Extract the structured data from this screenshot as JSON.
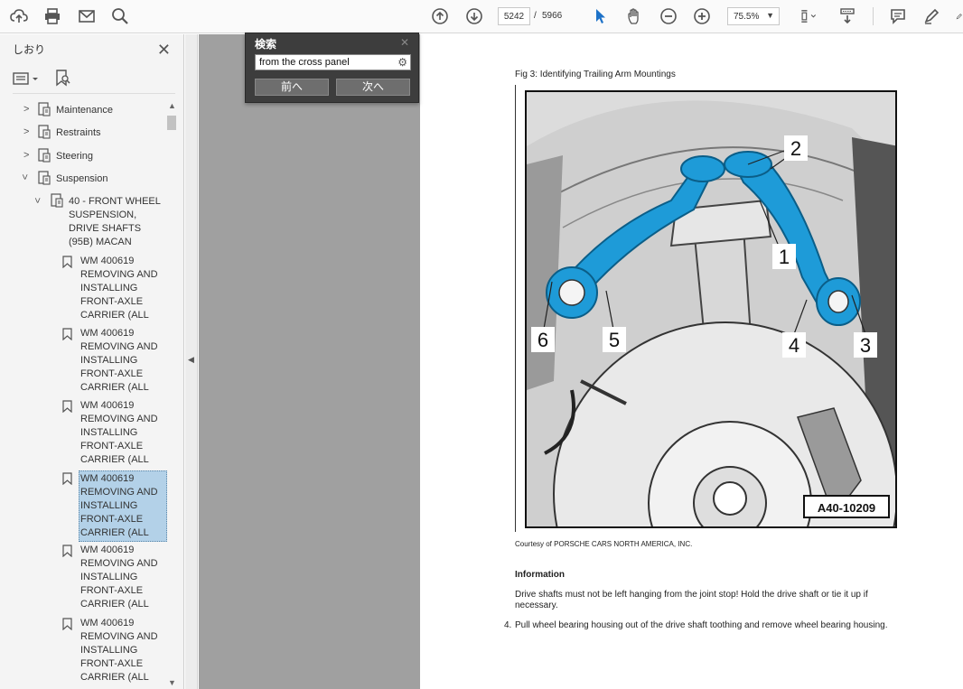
{
  "toolbar": {
    "page_current": "5242",
    "page_sep": "/",
    "page_total": "5966",
    "zoom": "75.5%"
  },
  "bookmarks": {
    "title": "しおり",
    "items": [
      {
        "label": "Maintenance"
      },
      {
        "label": "Restraints"
      },
      {
        "label": "Steering"
      },
      {
        "label": "Suspension"
      },
      {
        "label": "40 - FRONT WHEEL SUSPENSION, DRIVE SHAFTS (95B) MACAN"
      },
      {
        "label": "WM 400619 REMOVING AND INSTALLING FRONT-AXLE CARRIER (ALL"
      },
      {
        "label": "WM 400619 REMOVING AND INSTALLING FRONT-AXLE CARRIER (ALL"
      },
      {
        "label": "WM 400619 REMOVING AND INSTALLING FRONT-AXLE CARRIER (ALL"
      },
      {
        "label": "WM 400619 REMOVING AND INSTALLING FRONT-AXLE CARRIER (ALL"
      },
      {
        "label": "WM 400619 REMOVING AND INSTALLING FRONT-AXLE CARRIER (ALL"
      },
      {
        "label": "WM 400619 REMOVING AND INSTALLING FRONT-AXLE CARRIER (ALL"
      }
    ]
  },
  "find": {
    "title": "検索",
    "value": "from the cross panel",
    "prev_label": "前へ",
    "next_label": "次へ"
  },
  "document": {
    "fig_caption": "Fig 3: Identifying Trailing Arm Mountings",
    "callouts": [
      "1",
      "2",
      "3",
      "4",
      "5",
      "6"
    ],
    "figure_code": "A40-10209",
    "courtesy": "Courtesy of PORSCHE CARS NORTH AMERICA, INC.",
    "info_heading": "Information",
    "info_text": "Drive shafts must not be left hanging from the joint stop! Hold the drive shaft or tie it up if necessary.",
    "step_number": "4.",
    "step_text": "Pull wheel bearing housing out of the drive shaft toothing and remove wheel bearing housing."
  },
  "colors": {
    "accent": "#1e72c8",
    "selection": "#b3d1e8",
    "arm_blue": "#1e9bd8"
  }
}
